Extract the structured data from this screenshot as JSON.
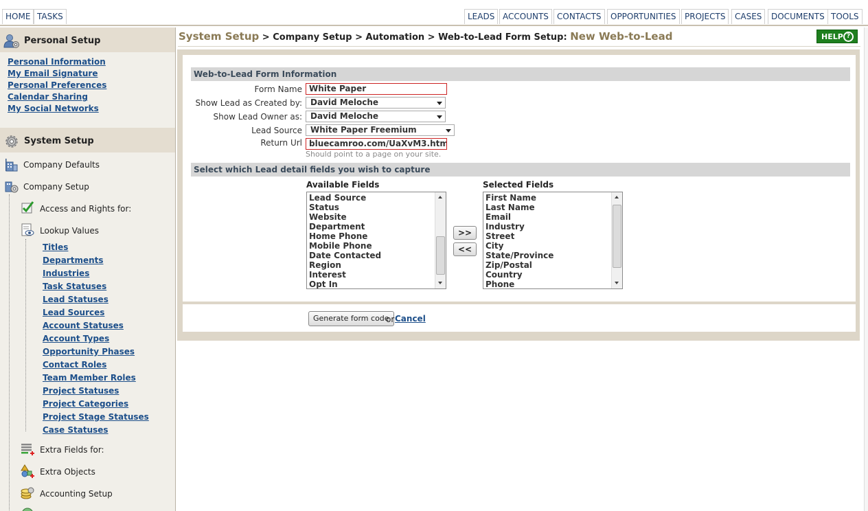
{
  "nav": {
    "left_tabs": [
      "HOME",
      "TASKS"
    ],
    "right_tabs": [
      "LEADS",
      "ACCOUNTS",
      "CONTACTS",
      "OPPORTUNITIES",
      "PROJECTS",
      "CASES",
      "DOCUMENTS",
      "TOOLS"
    ]
  },
  "sidebar": {
    "personal_title": "Personal Setup",
    "personal_links": [
      "Personal Information",
      "My Email Signature",
      "Personal Preferences",
      "Calendar Sharing",
      "My Social Networks"
    ],
    "system_title": "System Setup",
    "company_defaults": "Company Defaults",
    "company_setup": "Company Setup",
    "access_rights": "Access and Rights for:",
    "lookup_values": "Lookup Values",
    "lookup_links": [
      "Titles",
      "Departments",
      "Industries",
      "Task Statuses",
      "Lead Statuses",
      "Lead Sources",
      "Account Statuses",
      "Account Types",
      "Opportunity Phases",
      "Contact Roles",
      "Team Member Roles",
      "Project Statuses",
      "Project Categories",
      "Project Stage Statuses",
      "Case Statuses"
    ],
    "extra_fields": "Extra Fields for:",
    "extra_objects": "Extra Objects",
    "accounting_setup": "Accounting Setup"
  },
  "breadcrumb": {
    "first": "System Setup",
    "sep": " > ",
    "middle": [
      "Company Setup",
      "Automation",
      "Web-to-Lead Form Setup:"
    ],
    "last": "New Web-to-Lead"
  },
  "help_label": "HELP",
  "help_glyph": "?",
  "form": {
    "section1_title": "Web-to-Lead Form Information",
    "form_name_label": "Form Name",
    "form_name_value": "White Paper",
    "created_by_label": "Show Lead as Created by:",
    "created_by_value": "David Meloche",
    "owner_label": "Show Lead Owner as:",
    "owner_value": "David Meloche",
    "lead_source_label": "Lead Source",
    "lead_source_value": "White Paper Freemium",
    "return_url_label": "Return Url",
    "return_url_value": "bluecamroo.com/UaXvM3.htm",
    "return_url_hint": "Should point to a page on your site.",
    "section2_title": "Select which Lead detail fields you wish to capture",
    "available_title": "Available Fields",
    "available_fields": [
      "Lead Source",
      "Status",
      "Website",
      "Department",
      "Home Phone",
      "Mobile Phone",
      "Date Contacted",
      "Region",
      "Interest",
      "Opt In"
    ],
    "selected_title": "Selected Fields",
    "selected_fields": [
      "First Name",
      "Last Name",
      "Email",
      "Industry",
      "Street",
      "City",
      "State/Province",
      "Zip/Postal",
      "Country",
      "Phone"
    ],
    "add_label": ">>",
    "remove_label": "<<",
    "generate_label": "Generate form code",
    "or_text": "or",
    "cancel_label": "Cancel"
  },
  "colors": {
    "accent_tan": "#8a7a55",
    "link_blue": "#1d4f8a",
    "help_green": "#1e7f1e",
    "required_red": "#cc2222"
  }
}
